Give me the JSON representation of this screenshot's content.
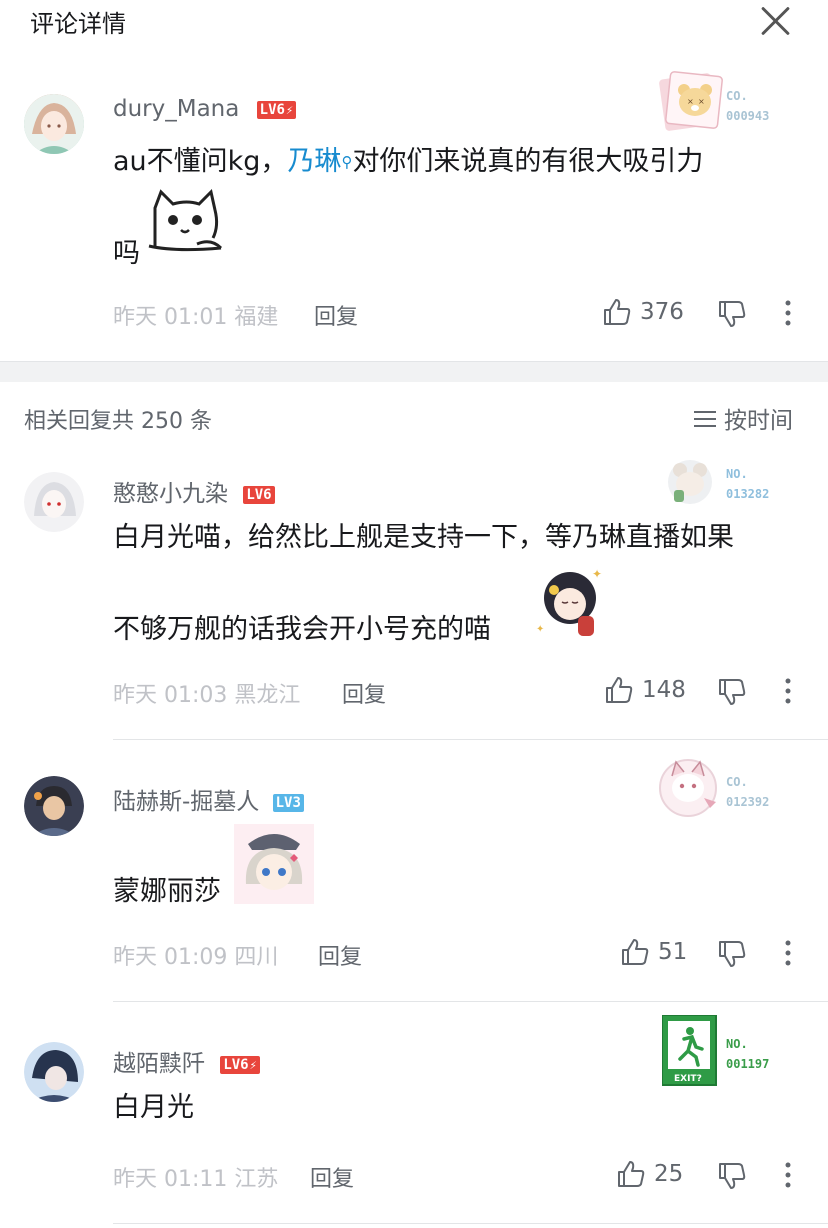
{
  "header": {
    "title": "评论详情"
  },
  "main_comment": {
    "username": "dury_Mana",
    "level": "LV6",
    "text_before": "au不懂问kg，",
    "mention": "乃琳",
    "text_after": "对你们来说真的有很大吸引力",
    "text_line2": "吗",
    "time": "昨天 01:01",
    "location": "福建",
    "reply_label": "回复",
    "likes": "376",
    "badge_prefix": "CO.",
    "badge_num": "000943"
  },
  "replies_header": {
    "count_text": "相关回复共 250 条",
    "sort_label": "按时间"
  },
  "replies": [
    {
      "username": "憨憨小九染",
      "level": "LV6",
      "text_line1": "白月光喵，给然比上舰是支持一下，等乃琳直播如果",
      "text_line2": "不够万舰的话我会开小号充的喵",
      "time": "昨天 01:03",
      "location": "黑龙江",
      "reply_label": "回复",
      "likes": "148",
      "badge_prefix": "NO.",
      "badge_num": "013282"
    },
    {
      "username": "陆赫斯-掘墓人",
      "level": "LV3",
      "text_line1": "蒙娜丽莎",
      "time": "昨天 01:09",
      "location": "四川",
      "reply_label": "回复",
      "likes": "51",
      "badge_prefix": "CO.",
      "badge_num": "012392"
    },
    {
      "username": "越陌黩阡",
      "level": "LV6",
      "text_line1": "白月光",
      "time": "昨天 01:11",
      "location": "江苏",
      "reply_label": "回复",
      "likes": "25",
      "badge_prefix": "NO.",
      "badge_num": "001197",
      "exit_label": "EXIT?"
    }
  ],
  "colors": {
    "mention": "#178bcf",
    "lv_red": "#e8453c",
    "lv_blue": "#57b6e8",
    "badge_teal": "#9bbfd4",
    "badge_green": "#3a9d4a"
  }
}
